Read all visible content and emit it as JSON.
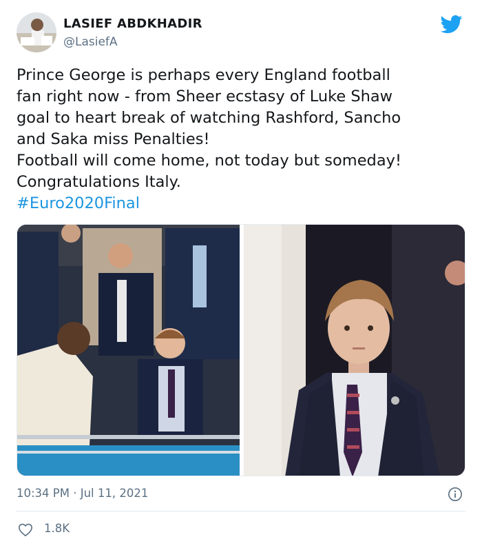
{
  "user": {
    "display_name": "LASIEF ABDKHADIR",
    "handle": "@LasiefA"
  },
  "icons": {
    "avatar": "profile-photo",
    "brand": "twitter-bird-icon",
    "info": "info-icon",
    "like": "heart-icon"
  },
  "colors": {
    "brand": "#1da1f2",
    "hashtag": "#1b95e0",
    "secondary_text": "#5b7083"
  },
  "tweet": {
    "lines": [
      "Prince George is perhaps every England football",
      "fan right now - from Sheer ecstasy of Luke Shaw",
      "goal to heart break of watching Rashford, Sancho",
      "and Saka miss Penalties!",
      "Football will come home, not today but someday!",
      "Congratulations Italy."
    ],
    "hashtag": "#Euro2020Final"
  },
  "media": {
    "left_photo": "Celebrating crowd in stadium box, boy cheering with arms out",
    "right_photo": "Boy in suit and striped tie looking disappointed"
  },
  "meta": {
    "timestamp": "10:34 PM · Jul 11, 2021"
  },
  "actions": {
    "likes": "1.8K"
  }
}
